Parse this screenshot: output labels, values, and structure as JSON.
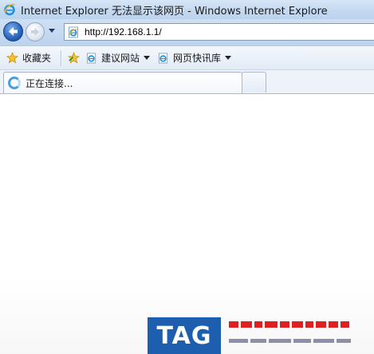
{
  "window": {
    "title": "Internet Explorer 无法显示该网页 - Windows Internet Explore"
  },
  "navigation": {
    "back_icon": "back-arrow-icon",
    "forward_icon": "forward-arrow-icon",
    "address": "http://192.168.1.1/"
  },
  "favorites_bar": {
    "favorites_label": "收藏夹",
    "items": [
      {
        "label": "建议网站",
        "icon": "ie-page-icon"
      },
      {
        "label": "网页快讯库",
        "icon": "ie-page-icon"
      }
    ]
  },
  "tabs": {
    "active": {
      "label": "正在连接...",
      "icon": "loading-icon"
    },
    "new_tab_icon": "new-tab-icon"
  },
  "watermark": {
    "logo_text": "TAG"
  },
  "colors": {
    "titlebar": "#c4d9f1",
    "accent_blue": "#1d5fae",
    "watermark_red": "#e02020"
  }
}
